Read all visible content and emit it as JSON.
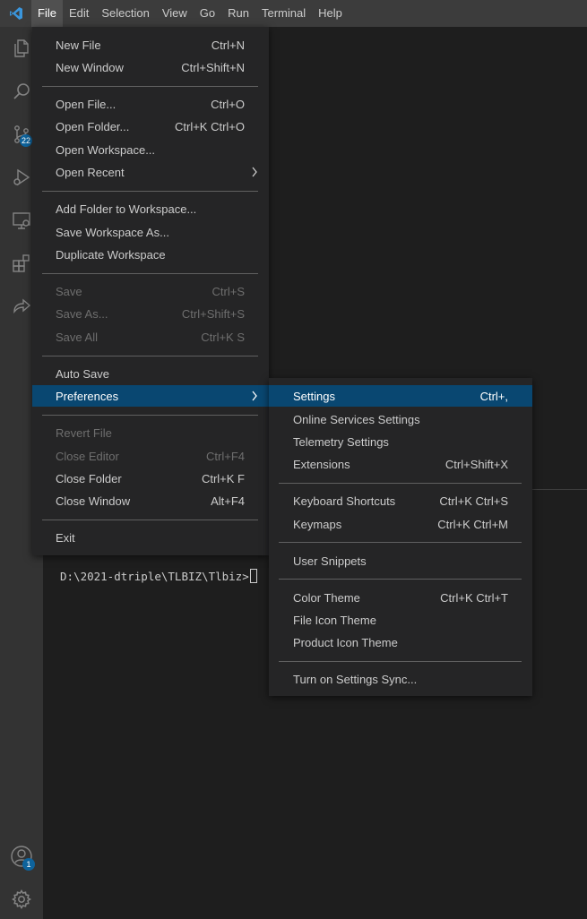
{
  "menubar": {
    "items": [
      "File",
      "Edit",
      "Selection",
      "View",
      "Go",
      "Run",
      "Terminal",
      "Help"
    ],
    "active": "File"
  },
  "activitybar": {
    "scm_badge": "22",
    "accounts_badge": "1",
    "icons": [
      "files-icon",
      "search-icon",
      "source-control-icon",
      "run-debug-icon",
      "remote-explorer-icon",
      "extensions-icon",
      "live-share-icon",
      "accounts-icon",
      "manage-gear-icon"
    ]
  },
  "file_menu": {
    "items": [
      {
        "label": "New File",
        "shortcut": "Ctrl+N",
        "disabled": false
      },
      {
        "label": "New Window",
        "shortcut": "Ctrl+Shift+N",
        "disabled": false
      },
      {
        "label": "Open File...",
        "shortcut": "Ctrl+O",
        "disabled": false
      },
      {
        "label": "Open Folder...",
        "shortcut": "Ctrl+K Ctrl+O",
        "disabled": false
      },
      {
        "label": "Open Workspace...",
        "shortcut": "",
        "disabled": false
      },
      {
        "label": "Open Recent",
        "shortcut": "",
        "disabled": false,
        "submenu": true
      },
      {
        "label": "Add Folder to Workspace...",
        "shortcut": "",
        "disabled": false
      },
      {
        "label": "Save Workspace As...",
        "shortcut": "",
        "disabled": false
      },
      {
        "label": "Duplicate Workspace",
        "shortcut": "",
        "disabled": false
      },
      {
        "label": "Save",
        "shortcut": "Ctrl+S",
        "disabled": true
      },
      {
        "label": "Save As...",
        "shortcut": "Ctrl+Shift+S",
        "disabled": true
      },
      {
        "label": "Save All",
        "shortcut": "Ctrl+K S",
        "disabled": true
      },
      {
        "label": "Auto Save",
        "shortcut": "",
        "disabled": false
      },
      {
        "label": "Preferences",
        "shortcut": "",
        "disabled": false,
        "submenu": true,
        "selected": true
      },
      {
        "label": "Revert File",
        "shortcut": "",
        "disabled": true
      },
      {
        "label": "Close Editor",
        "shortcut": "Ctrl+F4",
        "disabled": true
      },
      {
        "label": "Close Folder",
        "shortcut": "Ctrl+K F",
        "disabled": false
      },
      {
        "label": "Close Window",
        "shortcut": "Alt+F4",
        "disabled": false
      },
      {
        "label": "Exit",
        "shortcut": "",
        "disabled": false
      }
    ]
  },
  "preferences_menu": {
    "items": [
      {
        "label": "Settings",
        "shortcut": "Ctrl+,",
        "selected": true
      },
      {
        "label": "Online Services Settings",
        "shortcut": ""
      },
      {
        "label": "Telemetry Settings",
        "shortcut": ""
      },
      {
        "label": "Extensions",
        "shortcut": "Ctrl+Shift+X"
      },
      {
        "label": "Keyboard Shortcuts",
        "shortcut": "Ctrl+K Ctrl+S"
      },
      {
        "label": "Keymaps",
        "shortcut": "Ctrl+K Ctrl+M"
      },
      {
        "label": "User Snippets",
        "shortcut": ""
      },
      {
        "label": "Color Theme",
        "shortcut": "Ctrl+K Ctrl+T"
      },
      {
        "label": "File Icon Theme",
        "shortcut": ""
      },
      {
        "label": "Product Icon Theme",
        "shortcut": ""
      },
      {
        "label": "Turn on Settings Sync...",
        "shortcut": ""
      }
    ]
  },
  "terminal": {
    "prompt": "D:\\2021-dtriple\\TLBIZ\\Tlbiz>"
  },
  "colors": {
    "accent": "#094771",
    "badge": "#0e639c",
    "vscode_blue": "#3a96dd"
  }
}
